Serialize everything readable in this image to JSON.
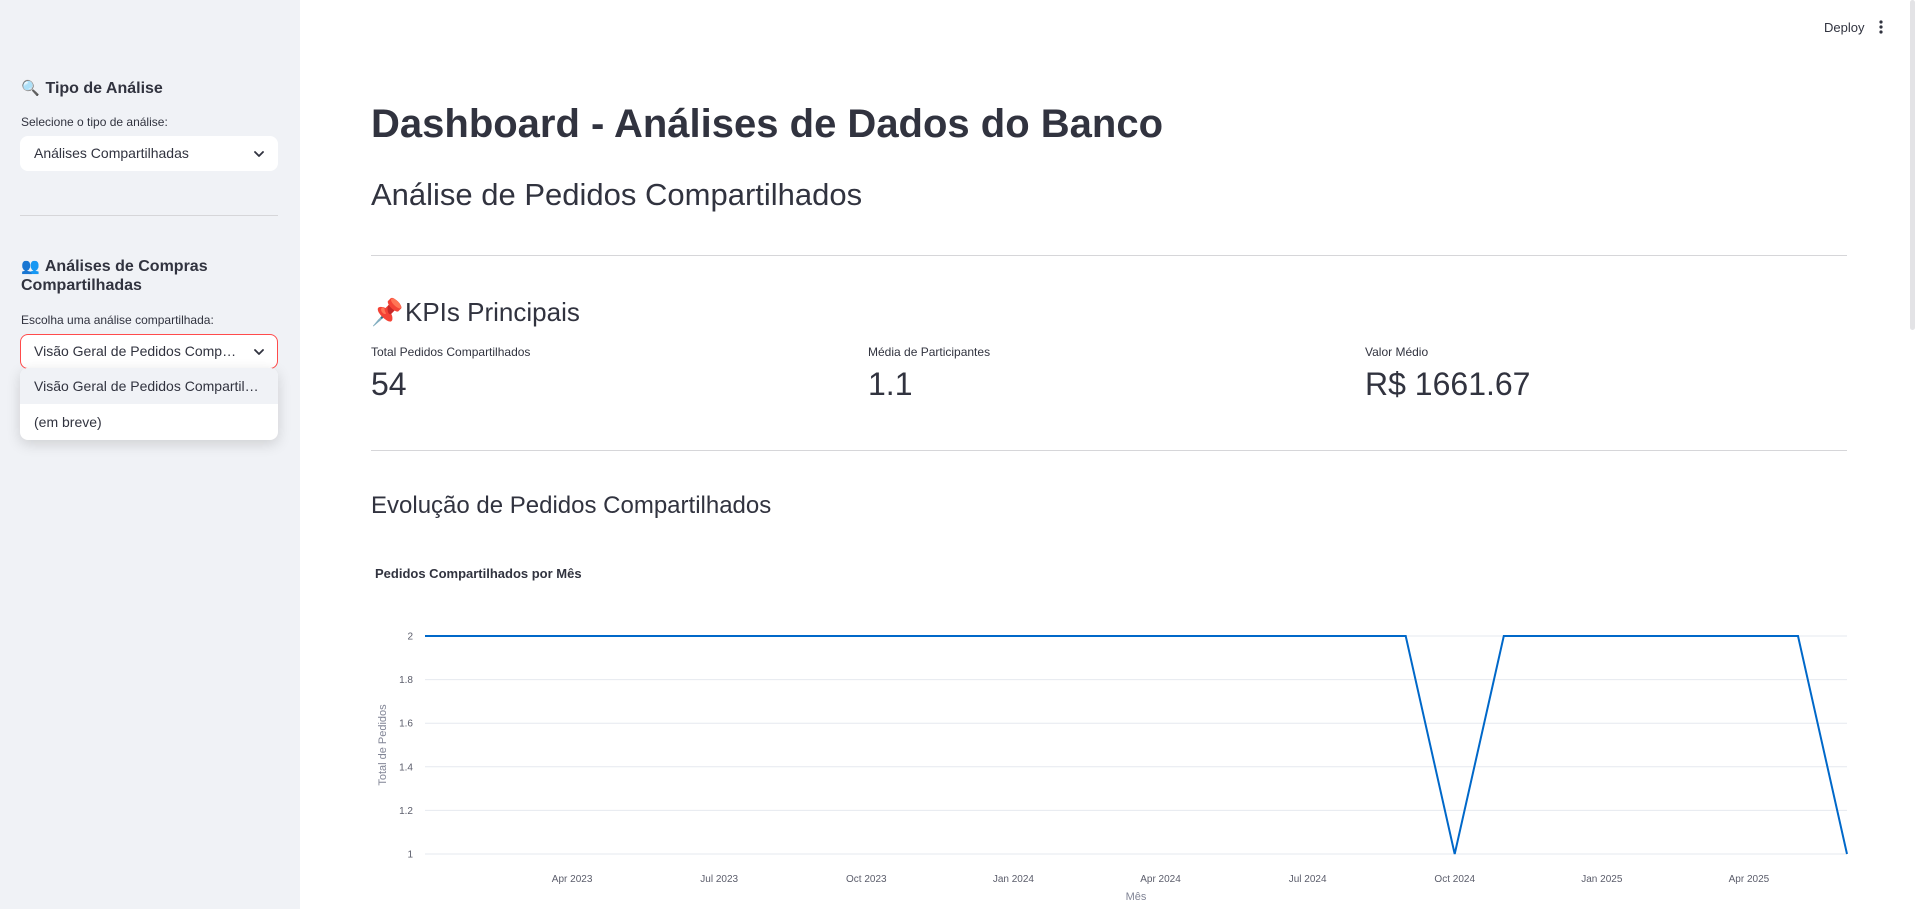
{
  "sidebar": {
    "analysis_type": {
      "emoji": "🔍",
      "title": "Tipo de Análise",
      "label": "Selecione o tipo de análise:",
      "selected": "Análises Compartilhadas"
    },
    "shared": {
      "emoji": "👥",
      "title_line1": "Análises de Compras",
      "title_line2": "Compartilhadas",
      "label": "Escolha uma análise compartilhada:",
      "selected": "Visão Geral de Pedidos Compartilhados",
      "options": [
        "Visão Geral de Pedidos Compartilhados",
        "(em breve)"
      ]
    }
  },
  "header": {
    "deploy_label": "Deploy",
    "menu_icon": "vertical-dots-icon"
  },
  "main": {
    "title": "Dashboard - Análises de Dados do Banco",
    "subtitle": "Análise de Pedidos Compartilhados",
    "kpi_section": {
      "emoji": "📌",
      "title": "KPIs Principais",
      "items": [
        {
          "label": "Total Pedidos Compartilhados",
          "value": "54"
        },
        {
          "label": "Média de Participantes",
          "value": "1.1"
        },
        {
          "label": "Valor Médio",
          "value": "R$ 1661.67"
        }
      ]
    },
    "evolution_title": "Evolução de Pedidos Compartilhados"
  },
  "colors": {
    "accent": "#ff4b4b",
    "line": "#0068c9",
    "sidebar_bg": "#f0f2f6",
    "text": "#31333f"
  },
  "chart_data": {
    "type": "line",
    "title": "Pedidos Compartilhados por Mês",
    "xlabel": "Mês",
    "ylabel": "Total de Pedidos",
    "x_ticks": [
      "Apr 2023",
      "Jul 2023",
      "Oct 2023",
      "Jan 2024",
      "Apr 2024",
      "Jul 2024",
      "Oct 2024",
      "Jan 2025",
      "Apr 2025"
    ],
    "y_ticks": [
      "1",
      "1.2",
      "1.4",
      "1.6",
      "1.8",
      "2"
    ],
    "ylim": [
      1,
      2
    ],
    "xlim": [
      "2023-01",
      "2025-06"
    ],
    "grid": true,
    "series": [
      {
        "x": [
          "2023-01",
          "2023-02",
          "2023-03",
          "2023-04",
          "2023-05",
          "2023-06",
          "2023-07",
          "2023-08",
          "2023-09",
          "2023-10",
          "2023-11",
          "2023-12",
          "2024-01",
          "2024-02",
          "2024-03",
          "2024-04",
          "2024-05",
          "2024-06",
          "2024-07",
          "2024-08",
          "2024-09",
          "2024-10",
          "2024-11",
          "2024-12",
          "2025-01",
          "2025-02",
          "2025-03",
          "2025-04",
          "2025-05",
          "2025-06"
        ],
        "y": [
          2,
          2,
          2,
          2,
          2,
          2,
          2,
          2,
          2,
          2,
          2,
          2,
          2,
          2,
          2,
          2,
          2,
          2,
          2,
          2,
          2,
          1,
          2,
          2,
          2,
          2,
          2,
          2,
          2,
          1
        ]
      }
    ]
  }
}
